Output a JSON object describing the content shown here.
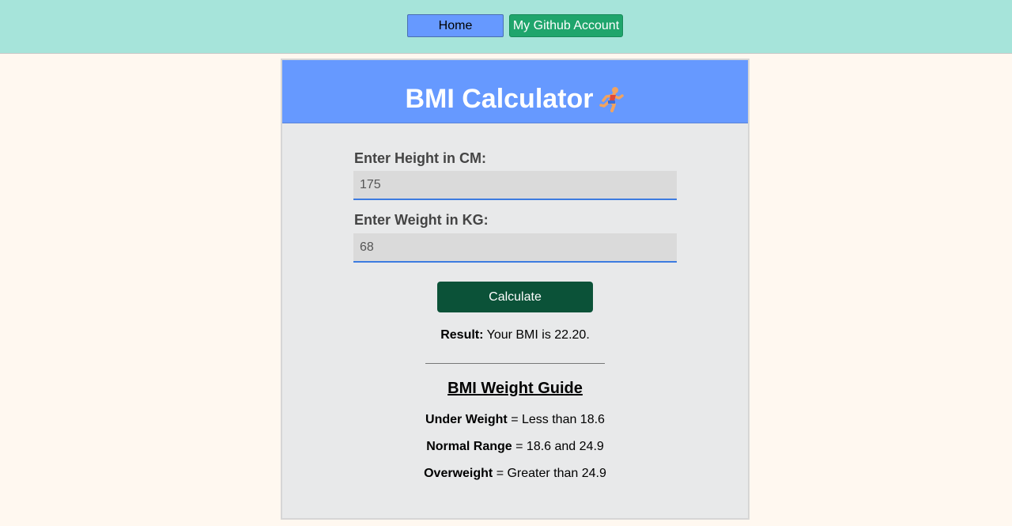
{
  "nav": {
    "home_label": "Home",
    "github_label": "My Github Account"
  },
  "header": {
    "title": "BMI Calculator",
    "icon": "running-person-emoji-icon"
  },
  "form": {
    "height_label": "Enter Height in CM:",
    "height_value": "175",
    "weight_label": "Enter Weight in KG:",
    "weight_value": "68",
    "calculate_label": "Calculate"
  },
  "result": {
    "prefix": "Result:",
    "text": "Your BMI is 22.20."
  },
  "guide": {
    "title": "BMI Weight Guide",
    "rows": [
      {
        "category": "Under Weight",
        "range": "= Less than 18.6"
      },
      {
        "category": "Normal Range",
        "range": "= 18.6 and 24.9"
      },
      {
        "category": "Overweight",
        "range": "= Greater than 24.9"
      }
    ]
  },
  "colors": {
    "topbar": "#a6e4da",
    "home_button": "#6699ff",
    "github_button": "#1fa56c",
    "card_header": "#6699ff",
    "calculate_button": "#0b5238",
    "page_background": "#fff8f0"
  }
}
